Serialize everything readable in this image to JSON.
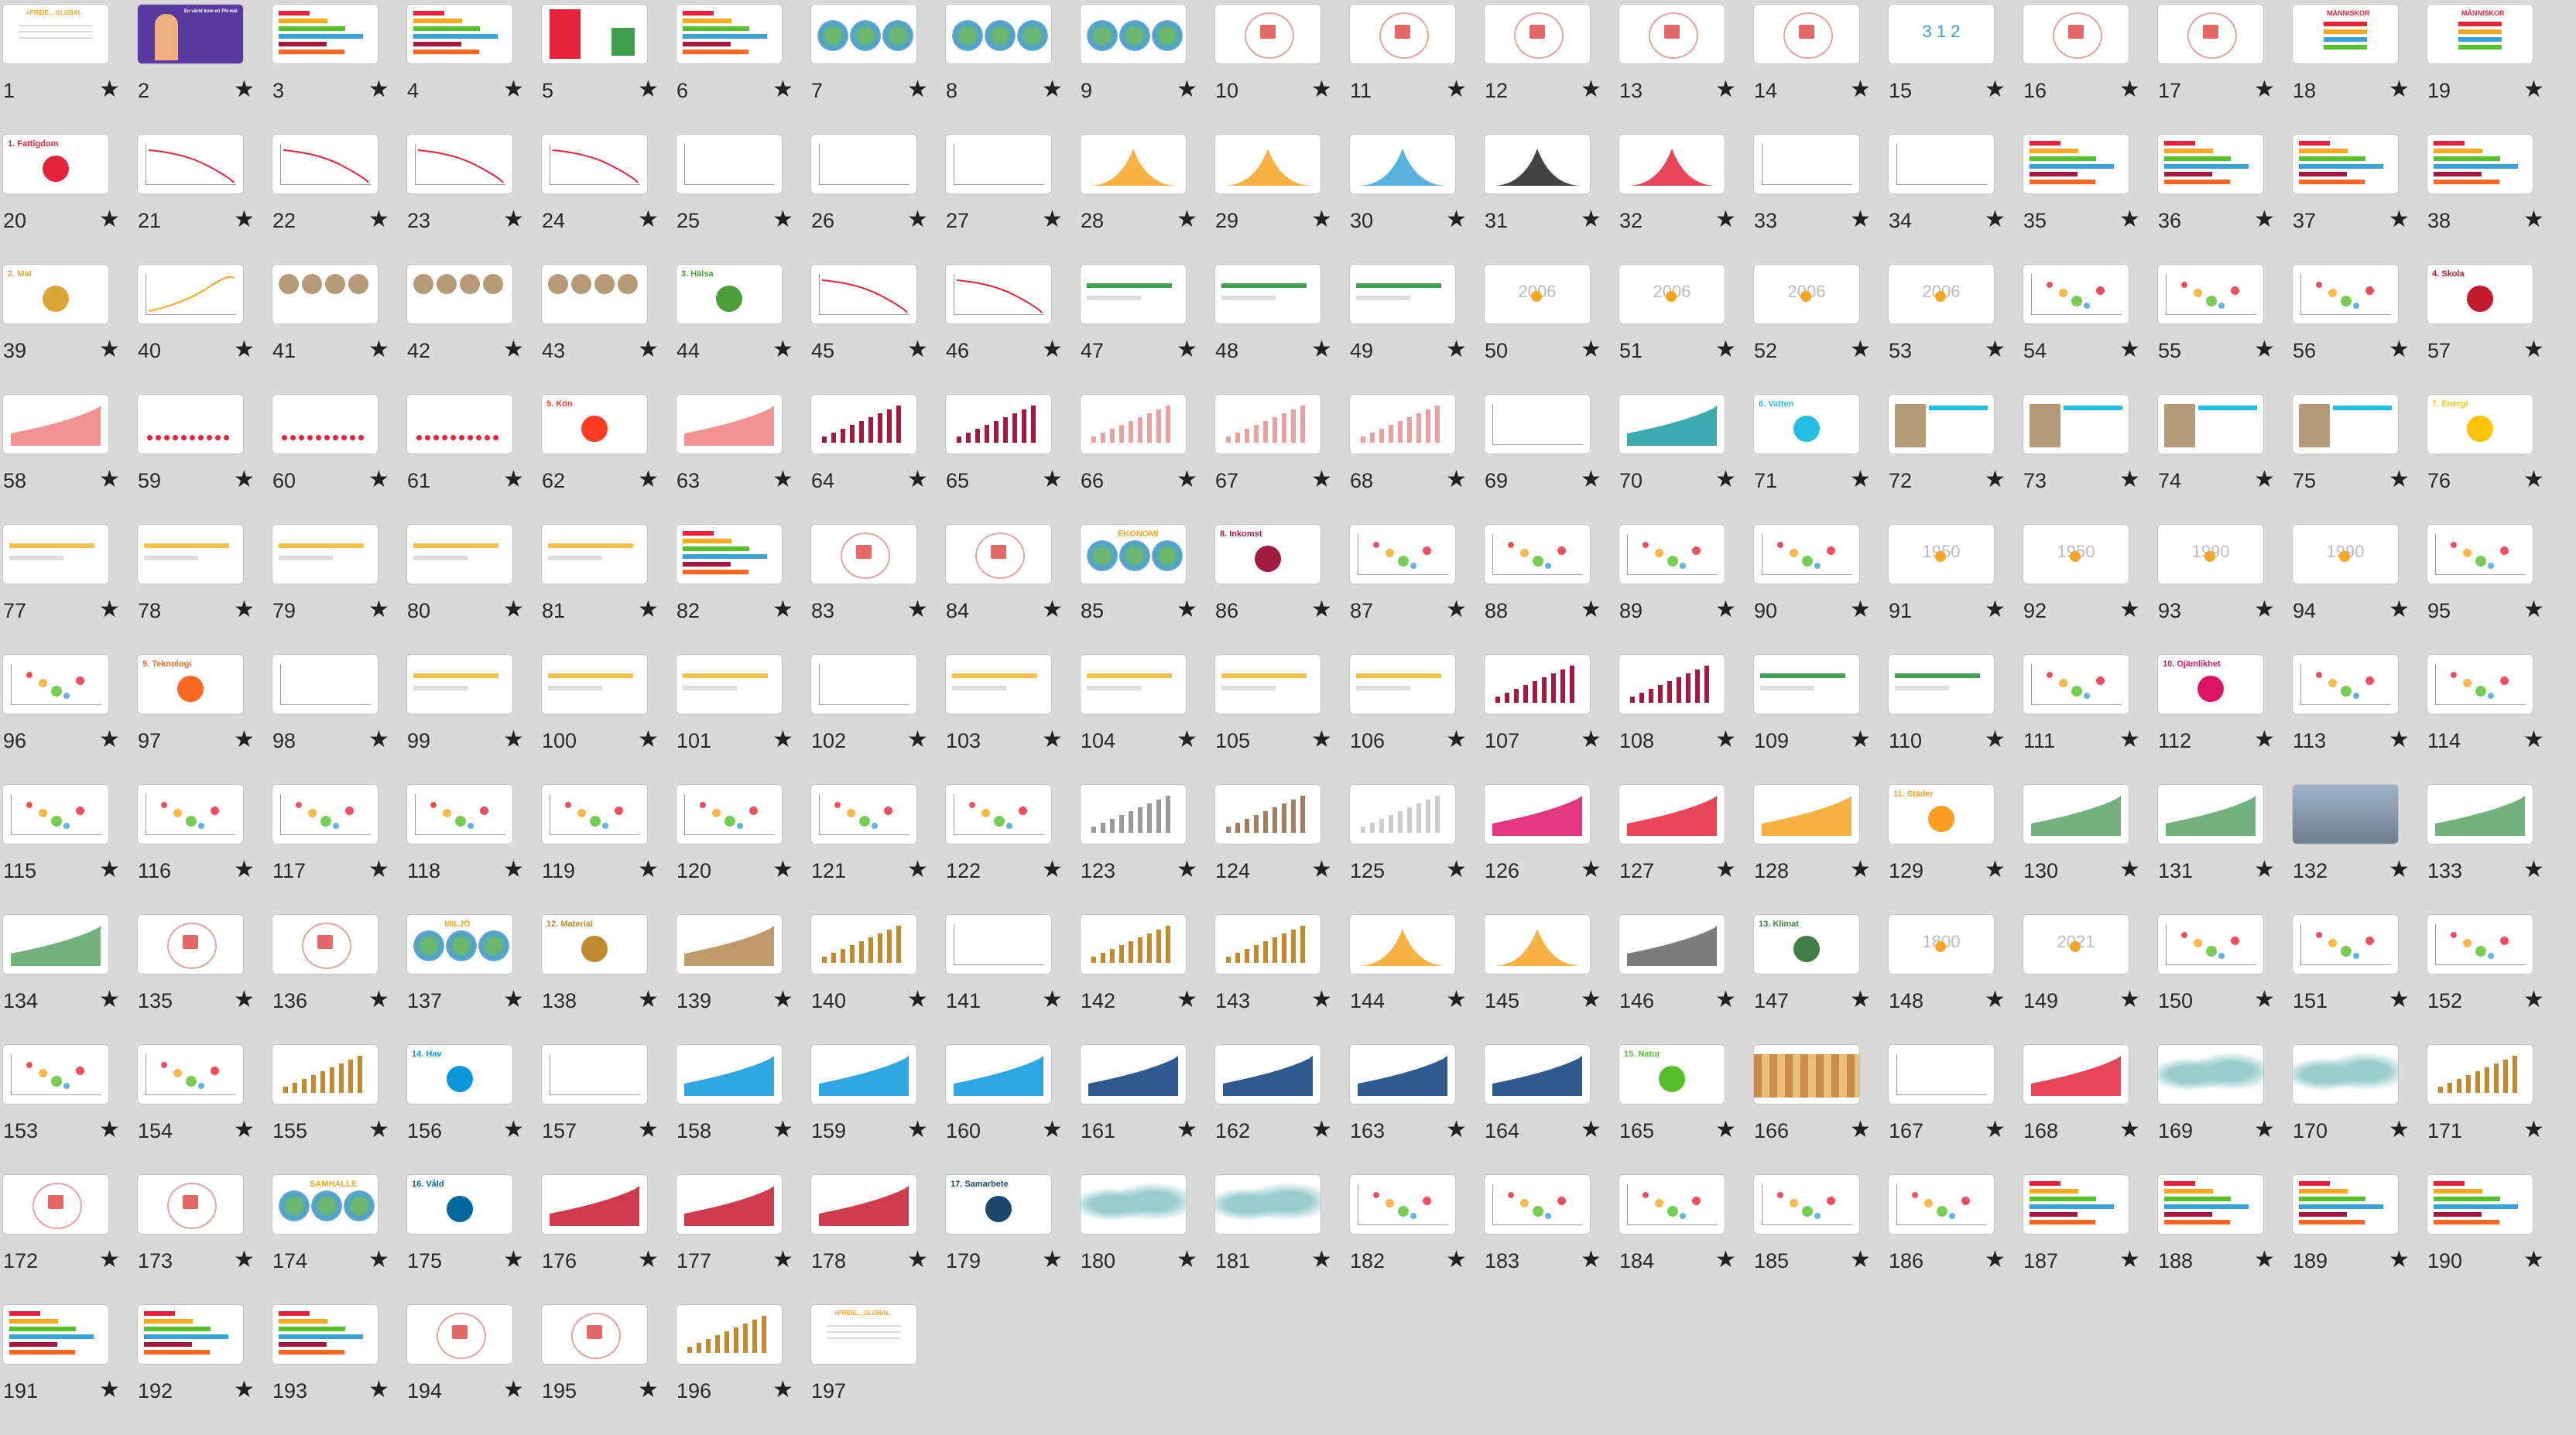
{
  "grid": {
    "star_glyph": "★",
    "slides": [
      {
        "n": "1",
        "kind": "banner",
        "title": "#PRIDE... GLOBAL"
      },
      {
        "n": "2",
        "kind": "person",
        "title": "En värld kom ett FN-mål"
      },
      {
        "n": "3",
        "kind": "list"
      },
      {
        "n": "4",
        "kind": "list"
      },
      {
        "n": "5",
        "kind": "redbox"
      },
      {
        "n": "6",
        "kind": "list"
      },
      {
        "n": "7",
        "kind": "globe"
      },
      {
        "n": "8",
        "kind": "globe"
      },
      {
        "n": "9",
        "kind": "globe"
      },
      {
        "n": "10",
        "kind": "logo"
      },
      {
        "n": "11",
        "kind": "logo"
      },
      {
        "n": "12",
        "kind": "logo"
      },
      {
        "n": "13",
        "kind": "logo"
      },
      {
        "n": "14",
        "kind": "logo"
      },
      {
        "n": "15",
        "kind": "digits",
        "title": "3 1 2"
      },
      {
        "n": "16",
        "kind": "logo"
      },
      {
        "n": "17",
        "kind": "logo"
      },
      {
        "n": "18",
        "kind": "people",
        "title": "MÄNNISKOR"
      },
      {
        "n": "19",
        "kind": "people",
        "title": "MÄNNISKOR"
      },
      {
        "n": "20",
        "kind": "goal",
        "title": "1. Fattigdom",
        "color": "#e5243b"
      },
      {
        "n": "21",
        "kind": "declining"
      },
      {
        "n": "22",
        "kind": "declining"
      },
      {
        "n": "23",
        "kind": "declining"
      },
      {
        "n": "24",
        "kind": "declining"
      },
      {
        "n": "25",
        "kind": "blank-chart"
      },
      {
        "n": "26",
        "kind": "blank-chart"
      },
      {
        "n": "27",
        "kind": "blank-chart"
      },
      {
        "n": "28",
        "kind": "mountain",
        "color": "#f5a623"
      },
      {
        "n": "29",
        "kind": "mountain",
        "color": "#f5a623"
      },
      {
        "n": "30",
        "kind": "mountain",
        "color": "#3ba3d9"
      },
      {
        "n": "31",
        "kind": "mountain",
        "color": "#222222"
      },
      {
        "n": "32",
        "kind": "mountain",
        "color": "#e5243b"
      },
      {
        "n": "33",
        "kind": "blank-chart"
      },
      {
        "n": "34",
        "kind": "blank-chart"
      },
      {
        "n": "35",
        "kind": "rows"
      },
      {
        "n": "36",
        "kind": "rows"
      },
      {
        "n": "37",
        "kind": "rows"
      },
      {
        "n": "38",
        "kind": "rows"
      },
      {
        "n": "39",
        "kind": "goal",
        "title": "2. Mat",
        "color": "#dda63a"
      },
      {
        "n": "40",
        "kind": "rising"
      },
      {
        "n": "41",
        "kind": "photos"
      },
      {
        "n": "42",
        "kind": "photos"
      },
      {
        "n": "43",
        "kind": "photos"
      },
      {
        "n": "44",
        "kind": "goal",
        "title": "3. Hälsa",
        "color": "#4c9f38"
      },
      {
        "n": "45",
        "kind": "declining"
      },
      {
        "n": "46",
        "kind": "declining"
      },
      {
        "n": "47",
        "kind": "greenbar"
      },
      {
        "n": "48",
        "kind": "greenbar"
      },
      {
        "n": "49",
        "kind": "greenbar"
      },
      {
        "n": "50",
        "kind": "year",
        "title": "2006"
      },
      {
        "n": "51",
        "kind": "year",
        "title": "2006"
      },
      {
        "n": "52",
        "kind": "year",
        "title": "2006"
      },
      {
        "n": "53",
        "kind": "year",
        "title": "2006"
      },
      {
        "n": "54",
        "kind": "scatter"
      },
      {
        "n": "55",
        "kind": "scatter"
      },
      {
        "n": "56",
        "kind": "scatter"
      },
      {
        "n": "57",
        "kind": "goal",
        "title": "4. Skola",
        "color": "#c5192d"
      },
      {
        "n": "58",
        "kind": "area",
        "color": "#f08080"
      },
      {
        "n": "59",
        "kind": "dots"
      },
      {
        "n": "60",
        "kind": "dots"
      },
      {
        "n": "61",
        "kind": "dots"
      },
      {
        "n": "62",
        "kind": "goal",
        "title": "5. Kön",
        "color": "#ff3a21"
      },
      {
        "n": "63",
        "kind": "area",
        "color": "#f08080"
      },
      {
        "n": "64",
        "kind": "bars",
        "color": "#a21942"
      },
      {
        "n": "65",
        "kind": "bars",
        "color": "#a21942"
      },
      {
        "n": "66",
        "kind": "bars",
        "color": "#e8a0a0"
      },
      {
        "n": "67",
        "kind": "bars",
        "color": "#e8a0a0"
      },
      {
        "n": "68",
        "kind": "bars",
        "color": "#e8a0a0"
      },
      {
        "n": "69",
        "kind": "blank-chart"
      },
      {
        "n": "70",
        "kind": "teal"
      },
      {
        "n": "71",
        "kind": "goal",
        "title": "6. Vatten",
        "color": "#26bde2"
      },
      {
        "n": "72",
        "kind": "photo-bar"
      },
      {
        "n": "73",
        "kind": "photo-bar"
      },
      {
        "n": "74",
        "kind": "photo-bar"
      },
      {
        "n": "75",
        "kind": "photo-bar"
      },
      {
        "n": "76",
        "kind": "goal",
        "title": "7. Energi",
        "color": "#fcc30b"
      },
      {
        "n": "77",
        "kind": "yellowbar"
      },
      {
        "n": "78",
        "kind": "yellowbar"
      },
      {
        "n": "79",
        "kind": "yellowbar"
      },
      {
        "n": "80",
        "kind": "yellowbar"
      },
      {
        "n": "81",
        "kind": "yellowbar"
      },
      {
        "n": "82",
        "kind": "rows"
      },
      {
        "n": "83",
        "kind": "logo"
      },
      {
        "n": "84",
        "kind": "logo"
      },
      {
        "n": "85",
        "kind": "globe",
        "title": "EKONOMI"
      },
      {
        "n": "86",
        "kind": "goal",
        "title": "8. Inkomst",
        "color": "#a21942"
      },
      {
        "n": "87",
        "kind": "scatter"
      },
      {
        "n": "88",
        "kind": "scatter"
      },
      {
        "n": "89",
        "kind": "scatter"
      },
      {
        "n": "90",
        "kind": "scatter"
      },
      {
        "n": "91",
        "kind": "year",
        "title": "1950"
      },
      {
        "n": "92",
        "kind": "year",
        "title": "1950"
      },
      {
        "n": "93",
        "kind": "year",
        "title": "1990"
      },
      {
        "n": "94",
        "kind": "year",
        "title": "1990"
      },
      {
        "n": "95",
        "kind": "scatter"
      },
      {
        "n": "96",
        "kind": "scatter"
      },
      {
        "n": "97",
        "kind": "goal",
        "title": "9. Teknologi",
        "color": "#fd6925"
      },
      {
        "n": "98",
        "kind": "blank-chart"
      },
      {
        "n": "99",
        "kind": "yellowbar"
      },
      {
        "n": "100",
        "kind": "yellowbar"
      },
      {
        "n": "101",
        "kind": "yellowbar"
      },
      {
        "n": "102",
        "kind": "blank-chart"
      },
      {
        "n": "103",
        "kind": "yellowbar"
      },
      {
        "n": "104",
        "kind": "yellowbar"
      },
      {
        "n": "105",
        "kind": "yellowbar"
      },
      {
        "n": "106",
        "kind": "yellowbar"
      },
      {
        "n": "107",
        "kind": "bars",
        "color": "#a21942"
      },
      {
        "n": "108",
        "kind": "bars",
        "color": "#a21942"
      },
      {
        "n": "109",
        "kind": "greenbar"
      },
      {
        "n": "110",
        "kind": "greenbar"
      },
      {
        "n": "111",
        "kind": "scatter"
      },
      {
        "n": "112",
        "kind": "goal",
        "title": "10. Ojämlikhet",
        "color": "#dd1367"
      },
      {
        "n": "113",
        "kind": "scatter"
      },
      {
        "n": "114",
        "kind": "scatter"
      },
      {
        "n": "115",
        "kind": "scatter"
      },
      {
        "n": "116",
        "kind": "scatter"
      },
      {
        "n": "117",
        "kind": "scatter"
      },
      {
        "n": "118",
        "kind": "scatter"
      },
      {
        "n": "119",
        "kind": "scatter"
      },
      {
        "n": "120",
        "kind": "scatter"
      },
      {
        "n": "121",
        "kind": "scatter"
      },
      {
        "n": "122",
        "kind": "scatter"
      },
      {
        "n": "123",
        "kind": "bars",
        "color": "#999999"
      },
      {
        "n": "124",
        "kind": "bars",
        "color": "#a08060"
      },
      {
        "n": "125",
        "kind": "bars",
        "color": "#cccccc"
      },
      {
        "n": "126",
        "kind": "area",
        "color": "#dd1367"
      },
      {
        "n": "127",
        "kind": "area",
        "color": "#e5243b"
      },
      {
        "n": "128",
        "kind": "area",
        "color": "#f5a623"
      },
      {
        "n": "129",
        "kind": "goal",
        "title": "11. Städer",
        "color": "#fd9d24"
      },
      {
        "n": "130",
        "kind": "area",
        "color": "#5aa469"
      },
      {
        "n": "131",
        "kind": "area",
        "color": "#5aa469"
      },
      {
        "n": "132",
        "kind": "photo"
      },
      {
        "n": "133",
        "kind": "area",
        "color": "#5aa469"
      },
      {
        "n": "134",
        "kind": "area",
        "color": "#5aa469"
      },
      {
        "n": "135",
        "kind": "logo"
      },
      {
        "n": "136",
        "kind": "logo"
      },
      {
        "n": "137",
        "kind": "globe",
        "title": "MILJÖ"
      },
      {
        "n": "138",
        "kind": "goal",
        "title": "12. Material",
        "color": "#bf8b2e"
      },
      {
        "n": "139",
        "kind": "area",
        "color": "#b08850"
      },
      {
        "n": "140",
        "kind": "bars",
        "color": "#bf8b2e"
      },
      {
        "n": "141",
        "kind": "blank-chart"
      },
      {
        "n": "142",
        "kind": "bars",
        "color": "#bf8b2e"
      },
      {
        "n": "143",
        "kind": "bars",
        "color": "#bf8b2e"
      },
      {
        "n": "144",
        "kind": "mountain",
        "color": "#f5a623"
      },
      {
        "n": "145",
        "kind": "mountain",
        "color": "#f5a623"
      },
      {
        "n": "146",
        "kind": "area",
        "color": "#666666"
      },
      {
        "n": "147",
        "kind": "goal",
        "title": "13. Klimat",
        "color": "#3f7e44"
      },
      {
        "n": "148",
        "kind": "year",
        "title": "1800"
      },
      {
        "n": "149",
        "kind": "year",
        "title": "2021"
      },
      {
        "n": "150",
        "kind": "scatter"
      },
      {
        "n": "151",
        "kind": "scatter"
      },
      {
        "n": "152",
        "kind": "scatter"
      },
      {
        "n": "153",
        "kind": "scatter"
      },
      {
        "n": "154",
        "kind": "scatter"
      },
      {
        "n": "155",
        "kind": "bars",
        "color": "#bf8b2e"
      },
      {
        "n": "156",
        "kind": "goal",
        "title": "14. Hav",
        "color": "#0a97d9"
      },
      {
        "n": "157",
        "kind": "blank-chart"
      },
      {
        "n": "158",
        "kind": "area",
        "color": "#0a97d9"
      },
      {
        "n": "159",
        "kind": "area",
        "color": "#0a97d9"
      },
      {
        "n": "160",
        "kind": "area",
        "color": "#0a97d9"
      },
      {
        "n": "161",
        "kind": "area",
        "color": "#0a3d7a"
      },
      {
        "n": "162",
        "kind": "area",
        "color": "#0a3d7a"
      },
      {
        "n": "163",
        "kind": "area",
        "color": "#0a3d7a"
      },
      {
        "n": "164",
        "kind": "area",
        "color": "#0a3d7a"
      },
      {
        "n": "165",
        "kind": "goal",
        "title": "15. Natur",
        "color": "#56c02b"
      },
      {
        "n": "166",
        "kind": "animals"
      },
      {
        "n": "167",
        "kind": "blank-chart"
      },
      {
        "n": "168",
        "kind": "area",
        "color": "#e5243b"
      },
      {
        "n": "169",
        "kind": "map"
      },
      {
        "n": "170",
        "kind": "map"
      },
      {
        "n": "171",
        "kind": "bars",
        "color": "#bf8b2e"
      },
      {
        "n": "172",
        "kind": "logo"
      },
      {
        "n": "173",
        "kind": "logo"
      },
      {
        "n": "174",
        "kind": "globe",
        "title": "SAMHÄLLE"
      },
      {
        "n": "175",
        "kind": "goal",
        "title": "16. Våld",
        "color": "#00689d"
      },
      {
        "n": "176",
        "kind": "area",
        "color": "#c5192d"
      },
      {
        "n": "177",
        "kind": "area",
        "color": "#c5192d"
      },
      {
        "n": "178",
        "kind": "area",
        "color": "#c5192d"
      },
      {
        "n": "179",
        "kind": "goal",
        "title": "17. Samarbete",
        "color": "#19486a"
      },
      {
        "n": "180",
        "kind": "map"
      },
      {
        "n": "181",
        "kind": "map"
      },
      {
        "n": "182",
        "kind": "scatter"
      },
      {
        "n": "183",
        "kind": "scatter"
      },
      {
        "n": "184",
        "kind": "scatter"
      },
      {
        "n": "185",
        "kind": "scatter"
      },
      {
        "n": "186",
        "kind": "scatter"
      },
      {
        "n": "187",
        "kind": "rows"
      },
      {
        "n": "188",
        "kind": "rows"
      },
      {
        "n": "189",
        "kind": "rows"
      },
      {
        "n": "190",
        "kind": "rows"
      },
      {
        "n": "191",
        "kind": "rows"
      },
      {
        "n": "192",
        "kind": "rows"
      },
      {
        "n": "193",
        "kind": "rows"
      },
      {
        "n": "194",
        "kind": "logo"
      },
      {
        "n": "195",
        "kind": "logo"
      },
      {
        "n": "196",
        "kind": "bars",
        "color": "#bf8b2e"
      },
      {
        "n": "197",
        "kind": "banner",
        "title": "#PRIDE... GLOBAL"
      }
    ]
  }
}
